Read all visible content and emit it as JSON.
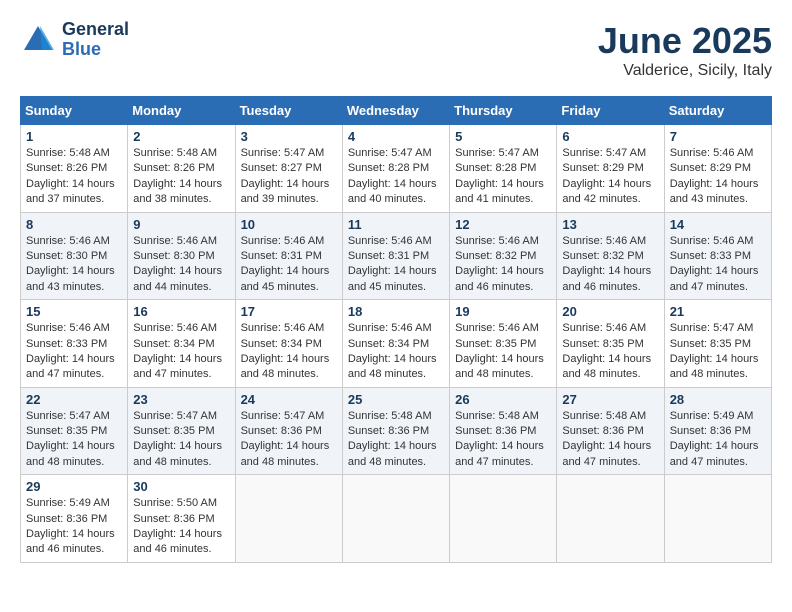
{
  "header": {
    "logo_line1": "General",
    "logo_line2": "Blue",
    "month": "June 2025",
    "location": "Valderice, Sicily, Italy"
  },
  "weekdays": [
    "Sunday",
    "Monday",
    "Tuesday",
    "Wednesday",
    "Thursday",
    "Friday",
    "Saturday"
  ],
  "weeks": [
    [
      {
        "day": "1",
        "sunrise": "Sunrise: 5:48 AM",
        "sunset": "Sunset: 8:26 PM",
        "daylight": "Daylight: 14 hours and 37 minutes."
      },
      {
        "day": "2",
        "sunrise": "Sunrise: 5:48 AM",
        "sunset": "Sunset: 8:26 PM",
        "daylight": "Daylight: 14 hours and 38 minutes."
      },
      {
        "day": "3",
        "sunrise": "Sunrise: 5:47 AM",
        "sunset": "Sunset: 8:27 PM",
        "daylight": "Daylight: 14 hours and 39 minutes."
      },
      {
        "day": "4",
        "sunrise": "Sunrise: 5:47 AM",
        "sunset": "Sunset: 8:28 PM",
        "daylight": "Daylight: 14 hours and 40 minutes."
      },
      {
        "day": "5",
        "sunrise": "Sunrise: 5:47 AM",
        "sunset": "Sunset: 8:28 PM",
        "daylight": "Daylight: 14 hours and 41 minutes."
      },
      {
        "day": "6",
        "sunrise": "Sunrise: 5:47 AM",
        "sunset": "Sunset: 8:29 PM",
        "daylight": "Daylight: 14 hours and 42 minutes."
      },
      {
        "day": "7",
        "sunrise": "Sunrise: 5:46 AM",
        "sunset": "Sunset: 8:29 PM",
        "daylight": "Daylight: 14 hours and 43 minutes."
      }
    ],
    [
      {
        "day": "8",
        "sunrise": "Sunrise: 5:46 AM",
        "sunset": "Sunset: 8:30 PM",
        "daylight": "Daylight: 14 hours and 43 minutes."
      },
      {
        "day": "9",
        "sunrise": "Sunrise: 5:46 AM",
        "sunset": "Sunset: 8:30 PM",
        "daylight": "Daylight: 14 hours and 44 minutes."
      },
      {
        "day": "10",
        "sunrise": "Sunrise: 5:46 AM",
        "sunset": "Sunset: 8:31 PM",
        "daylight": "Daylight: 14 hours and 45 minutes."
      },
      {
        "day": "11",
        "sunrise": "Sunrise: 5:46 AM",
        "sunset": "Sunset: 8:31 PM",
        "daylight": "Daylight: 14 hours and 45 minutes."
      },
      {
        "day": "12",
        "sunrise": "Sunrise: 5:46 AM",
        "sunset": "Sunset: 8:32 PM",
        "daylight": "Daylight: 14 hours and 46 minutes."
      },
      {
        "day": "13",
        "sunrise": "Sunrise: 5:46 AM",
        "sunset": "Sunset: 8:32 PM",
        "daylight": "Daylight: 14 hours and 46 minutes."
      },
      {
        "day": "14",
        "sunrise": "Sunrise: 5:46 AM",
        "sunset": "Sunset: 8:33 PM",
        "daylight": "Daylight: 14 hours and 47 minutes."
      }
    ],
    [
      {
        "day": "15",
        "sunrise": "Sunrise: 5:46 AM",
        "sunset": "Sunset: 8:33 PM",
        "daylight": "Daylight: 14 hours and 47 minutes."
      },
      {
        "day": "16",
        "sunrise": "Sunrise: 5:46 AM",
        "sunset": "Sunset: 8:34 PM",
        "daylight": "Daylight: 14 hours and 47 minutes."
      },
      {
        "day": "17",
        "sunrise": "Sunrise: 5:46 AM",
        "sunset": "Sunset: 8:34 PM",
        "daylight": "Daylight: 14 hours and 48 minutes."
      },
      {
        "day": "18",
        "sunrise": "Sunrise: 5:46 AM",
        "sunset": "Sunset: 8:34 PM",
        "daylight": "Daylight: 14 hours and 48 minutes."
      },
      {
        "day": "19",
        "sunrise": "Sunrise: 5:46 AM",
        "sunset": "Sunset: 8:35 PM",
        "daylight": "Daylight: 14 hours and 48 minutes."
      },
      {
        "day": "20",
        "sunrise": "Sunrise: 5:46 AM",
        "sunset": "Sunset: 8:35 PM",
        "daylight": "Daylight: 14 hours and 48 minutes."
      },
      {
        "day": "21",
        "sunrise": "Sunrise: 5:47 AM",
        "sunset": "Sunset: 8:35 PM",
        "daylight": "Daylight: 14 hours and 48 minutes."
      }
    ],
    [
      {
        "day": "22",
        "sunrise": "Sunrise: 5:47 AM",
        "sunset": "Sunset: 8:35 PM",
        "daylight": "Daylight: 14 hours and 48 minutes."
      },
      {
        "day": "23",
        "sunrise": "Sunrise: 5:47 AM",
        "sunset": "Sunset: 8:35 PM",
        "daylight": "Daylight: 14 hours and 48 minutes."
      },
      {
        "day": "24",
        "sunrise": "Sunrise: 5:47 AM",
        "sunset": "Sunset: 8:36 PM",
        "daylight": "Daylight: 14 hours and 48 minutes."
      },
      {
        "day": "25",
        "sunrise": "Sunrise: 5:48 AM",
        "sunset": "Sunset: 8:36 PM",
        "daylight": "Daylight: 14 hours and 48 minutes."
      },
      {
        "day": "26",
        "sunrise": "Sunrise: 5:48 AM",
        "sunset": "Sunset: 8:36 PM",
        "daylight": "Daylight: 14 hours and 47 minutes."
      },
      {
        "day": "27",
        "sunrise": "Sunrise: 5:48 AM",
        "sunset": "Sunset: 8:36 PM",
        "daylight": "Daylight: 14 hours and 47 minutes."
      },
      {
        "day": "28",
        "sunrise": "Sunrise: 5:49 AM",
        "sunset": "Sunset: 8:36 PM",
        "daylight": "Daylight: 14 hours and 47 minutes."
      }
    ],
    [
      {
        "day": "29",
        "sunrise": "Sunrise: 5:49 AM",
        "sunset": "Sunset: 8:36 PM",
        "daylight": "Daylight: 14 hours and 46 minutes."
      },
      {
        "day": "30",
        "sunrise": "Sunrise: 5:50 AM",
        "sunset": "Sunset: 8:36 PM",
        "daylight": "Daylight: 14 hours and 46 minutes."
      },
      null,
      null,
      null,
      null,
      null
    ]
  ]
}
